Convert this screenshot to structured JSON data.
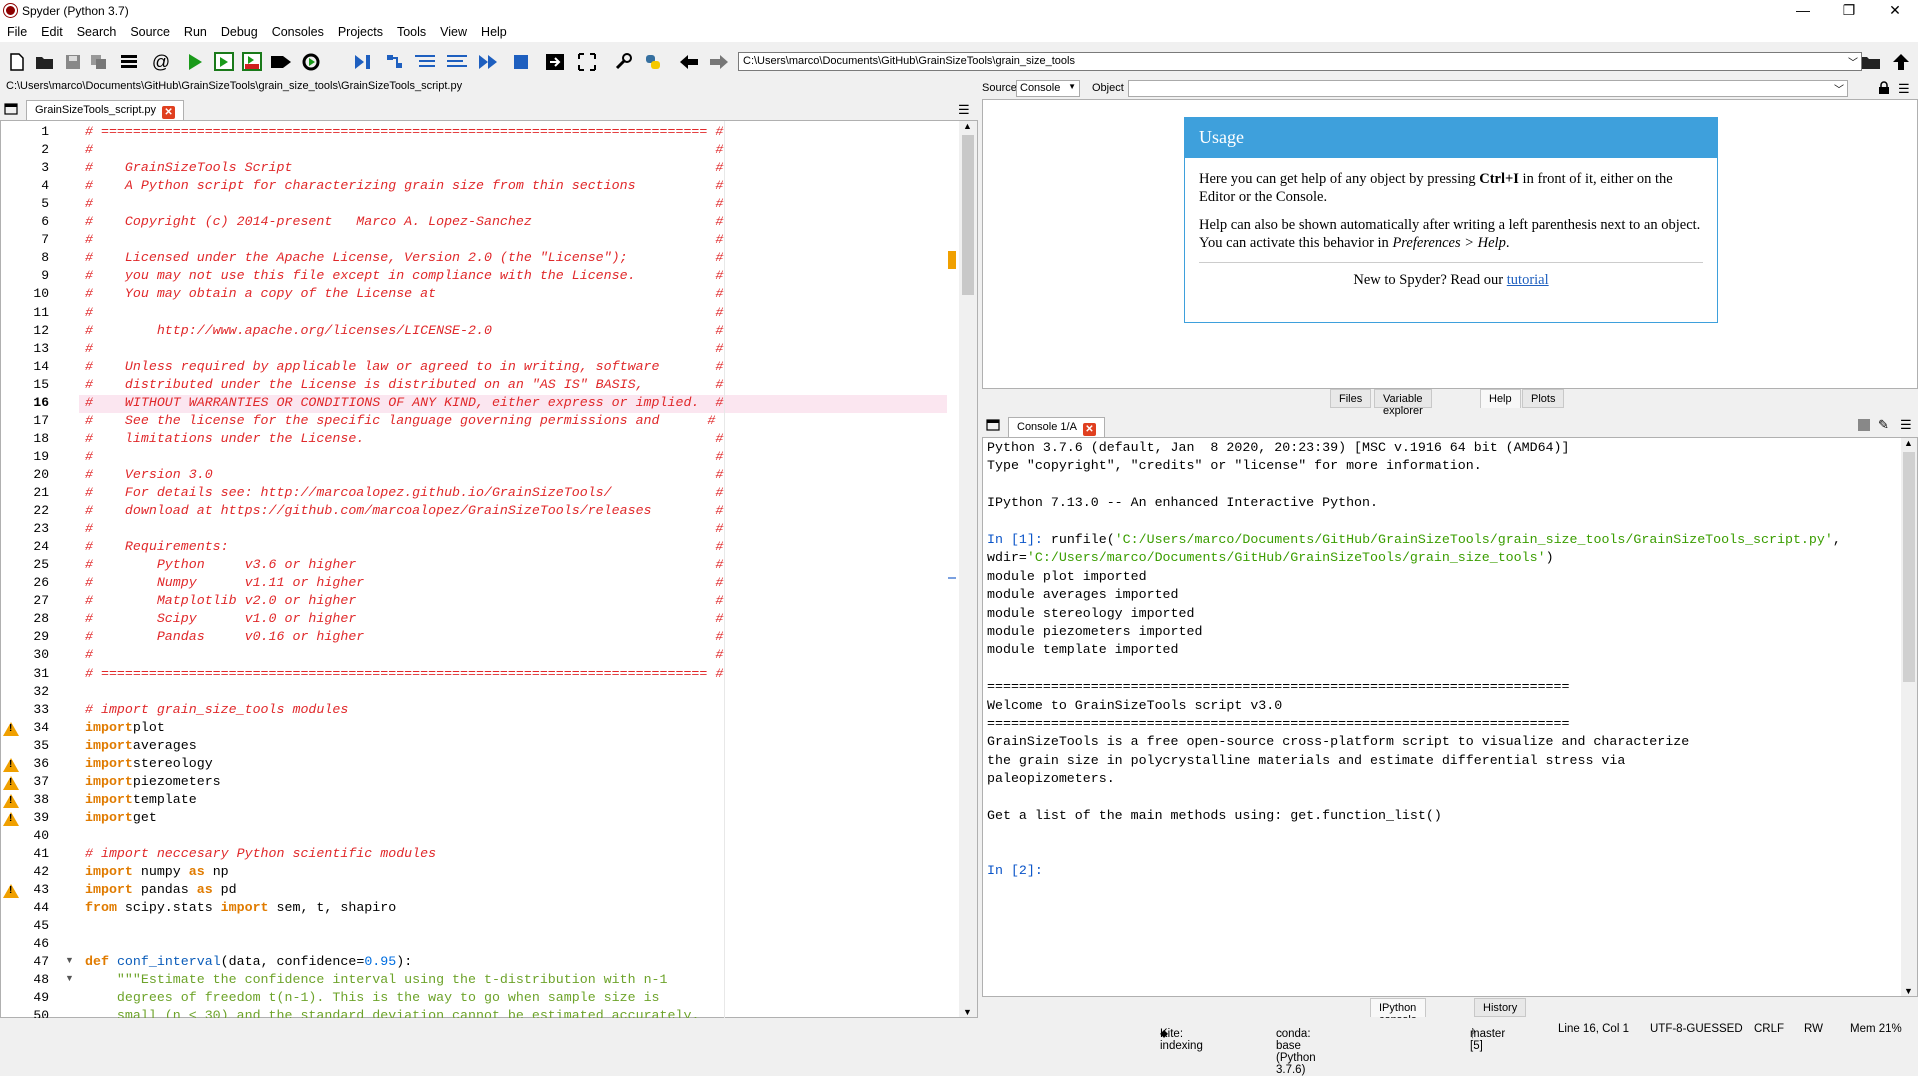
{
  "window": {
    "title": "Spyder (Python 3.7)",
    "minimize": "—",
    "restore": "❐",
    "close": "✕"
  },
  "menu": [
    "File",
    "Edit",
    "Search",
    "Source",
    "Run",
    "Debug",
    "Consoles",
    "Projects",
    "Tools",
    "View",
    "Help"
  ],
  "toolbar": {
    "path": "C:\\Users\\marco\\Documents\\GitHub\\GrainSizeTools\\grain_size_tools"
  },
  "editor": {
    "filepath": "C:\\Users\\marco\\Documents\\GitHub\\GrainSizeTools\\grain_size_tools\\GrainSizeTools_script.py",
    "tab": "GrainSizeTools_script.py",
    "current_line": 16,
    "warning_lines": [
      34,
      36,
      37,
      38,
      39,
      43
    ],
    "fold_lines": [
      47,
      48
    ],
    "lines": [
      [
        [
          "cmt",
          "# ============================================================================ #"
        ]
      ],
      [
        [
          "cmt",
          "#                                                                              #"
        ]
      ],
      [
        [
          "cmt",
          "#    GrainSizeTools Script                                                     #"
        ]
      ],
      [
        [
          "cmt",
          "#    A Python script for characterizing grain size from thin sections          #"
        ]
      ],
      [
        [
          "cmt",
          "#                                                                              #"
        ]
      ],
      [
        [
          "cmt",
          "#    Copyright (c) 2014-present   Marco A. Lopez-Sanchez                       #"
        ]
      ],
      [
        [
          "cmt",
          "#                                                                              #"
        ]
      ],
      [
        [
          "cmt",
          "#    Licensed under the Apache License, Version 2.0 (the \"License\");           #"
        ]
      ],
      [
        [
          "cmt",
          "#    you may not use this file except in compliance with the License.          #"
        ]
      ],
      [
        [
          "cmt",
          "#    You may obtain a copy of the License at                                   #"
        ]
      ],
      [
        [
          "cmt",
          "#                                                                              #"
        ]
      ],
      [
        [
          "cmt",
          "#        http://www.apache.org/licenses/LICENSE-2.0                            #"
        ]
      ],
      [
        [
          "cmt",
          "#                                                                              #"
        ]
      ],
      [
        [
          "cmt",
          "#    Unless required by applicable law or agreed to in writing, software       #"
        ]
      ],
      [
        [
          "cmt",
          "#    distributed under the License is distributed on an \"AS IS\" BASIS,         #"
        ]
      ],
      [
        [
          "cmt",
          "#    WITHOUT WARRANTIES OR CONDITIONS OF ANY KIND, either express or implied.  #"
        ]
      ],
      [
        [
          "cmt",
          "#    See the license for the specific language governing permissions and      #"
        ]
      ],
      [
        [
          "cmt",
          "#    limitations under the License.                                            #"
        ]
      ],
      [
        [
          "cmt",
          "#                                                                              #"
        ]
      ],
      [
        [
          "cmt",
          "#    Version 3.0                                                               #"
        ]
      ],
      [
        [
          "cmt",
          "#    For details see: http://marcoalopez.github.io/GrainSizeTools/             #"
        ]
      ],
      [
        [
          "cmt",
          "#    download at https://github.com/marcoalopez/GrainSizeTools/releases        #"
        ]
      ],
      [
        [
          "cmt",
          "#                                                                              #"
        ]
      ],
      [
        [
          "cmt",
          "#    Requirements:                                                             #"
        ]
      ],
      [
        [
          "cmt",
          "#        Python     v3.6 or higher                                             #"
        ]
      ],
      [
        [
          "cmt",
          "#        Numpy      v1.11 or higher                                            #"
        ]
      ],
      [
        [
          "cmt",
          "#        Matplotlib v2.0 or higher                                             #"
        ]
      ],
      [
        [
          "cmt",
          "#        Scipy      v1.0 or higher                                             #"
        ]
      ],
      [
        [
          "cmt",
          "#        Pandas     v0.16 or higher                                            #"
        ]
      ],
      [
        [
          "cmt",
          "#                                                                              #"
        ]
      ],
      [
        [
          "cmt",
          "# ============================================================================ #"
        ]
      ],
      [],
      [
        [
          "cmt",
          "# import grain_size_tools modules"
        ]
      ],
      [
        [
          "kw",
          "import"
        ],
        [
          "",
          "plot"
        ]
      ],
      [
        [
          "kw",
          "import"
        ],
        [
          "",
          "averages"
        ]
      ],
      [
        [
          "kw",
          "import"
        ],
        [
          "",
          "stereology"
        ]
      ],
      [
        [
          "kw",
          "import"
        ],
        [
          "",
          "piezometers"
        ]
      ],
      [
        [
          "kw",
          "import"
        ],
        [
          "",
          "template"
        ]
      ],
      [
        [
          "kw",
          "import"
        ],
        [
          "",
          "get"
        ]
      ],
      [],
      [
        [
          "cmt",
          "# import neccesary Python scientific modules"
        ]
      ],
      [
        [
          "kw",
          "import"
        ],
        [
          "",
          " numpy "
        ],
        [
          "kw",
          "as"
        ],
        [
          "",
          " np"
        ]
      ],
      [
        [
          "kw",
          "import"
        ],
        [
          "",
          " pandas "
        ],
        [
          "kw",
          "as"
        ],
        [
          "",
          " pd"
        ]
      ],
      [
        [
          "kw",
          "from"
        ],
        [
          "",
          " scipy.stats "
        ],
        [
          "kw",
          "import"
        ],
        [
          "",
          " sem, t, shapiro"
        ]
      ],
      [],
      [],
      [
        [
          "kw",
          "def"
        ],
        [
          "",
          " "
        ],
        [
          "def",
          "conf_interval"
        ],
        [
          "",
          "(data, confidence="
        ],
        [
          "num",
          "0.95"
        ],
        [
          "",
          "):"
        ]
      ],
      [
        [
          "",
          "    "
        ],
        [
          "str",
          "\"\"\"Estimate the confidence interval using the t-distribution with n-1"
        ]
      ],
      [
        [
          "",
          "    "
        ],
        [
          "str",
          "degrees of freedom t(n-1). This is the way to go when sample size is"
        ]
      ],
      [
        [
          "",
          "    "
        ],
        [
          "str",
          "small (n < 30) and the standard deviation cannot be estimated accurately."
        ]
      ]
    ]
  },
  "source_bar": {
    "source_label": "Source",
    "source_value": "Console",
    "object_label": "Object"
  },
  "help": {
    "title": "Usage",
    "p1_a": "Here you can get help of any object by pressing ",
    "p1_b": "Ctrl+I",
    "p1_c": " in front of it, either on the Editor or the Console.",
    "p2_a": "Help can also be shown automatically after writing a left parenthesis next to an object. You can activate this behavior in ",
    "p2_b": "Preferences > Help",
    "p2_c": ".",
    "p3_a": "New to Spyder? Read our ",
    "p3_link": "tutorial",
    "tabs": [
      "Files",
      "Variable explorer",
      "Help",
      "Plots"
    ]
  },
  "console": {
    "tab": "Console 1/A",
    "lines": [
      [
        [
          "",
          "Python 3.7.6 (default, Jan  8 2020, 20:23:39) [MSC v.1916 64 bit (AMD64)]"
        ]
      ],
      [
        [
          "",
          "Type \"copyright\", \"credits\" or \"license\" for more information."
        ]
      ],
      [],
      [
        [
          "",
          "IPython 7.13.0 -- An enhanced Interactive Python."
        ]
      ],
      [],
      [
        [
          "blu",
          "In ["
        ],
        [
          "blu",
          "1"
        ],
        [
          "blu",
          "]: "
        ],
        [
          "",
          "runfile("
        ],
        [
          "grn",
          "'C:/Users/marco/Documents/GitHub/GrainSizeTools/grain_size_tools/GrainSizeTools_script.py'"
        ],
        [
          "",
          ","
        ]
      ],
      [
        [
          "",
          "wdir="
        ],
        [
          "grn",
          "'C:/Users/marco/Documents/GitHub/GrainSizeTools/grain_size_tools'"
        ],
        [
          "",
          ")"
        ]
      ],
      [
        [
          "",
          "module plot imported"
        ]
      ],
      [
        [
          "",
          "module averages imported"
        ]
      ],
      [
        [
          "",
          "module stereology imported"
        ]
      ],
      [
        [
          "",
          "module piezometers imported"
        ]
      ],
      [
        [
          "",
          "module template imported"
        ]
      ],
      [],
      [
        [
          "",
          "========================================================================="
        ]
      ],
      [
        [
          "",
          "Welcome to GrainSizeTools script v3.0"
        ]
      ],
      [
        [
          "",
          "========================================================================="
        ]
      ],
      [
        [
          "",
          "GrainSizeTools is a free open-source cross-platform script to visualize and characterize"
        ]
      ],
      [
        [
          "",
          "the grain size in polycrystalline materials and estimate differential stress via"
        ]
      ],
      [
        [
          "",
          "paleopizometers."
        ]
      ],
      [],
      [
        [
          "",
          "Get a list of the main methods using: get.function_list()"
        ]
      ],
      [],
      [],
      [
        [
          "blu",
          "In [2]: "
        ]
      ]
    ],
    "bottom_tabs": [
      "IPython console",
      "History"
    ]
  },
  "status": {
    "kite": "Kite: indexing",
    "conda": "conda: base (Python 3.7.6)",
    "git": "master [5]",
    "position": "Line 16, Col 1",
    "encoding": "UTF-8-GUESSED",
    "eol": "CRLF",
    "rw": "RW",
    "mem": "Mem 21%"
  }
}
